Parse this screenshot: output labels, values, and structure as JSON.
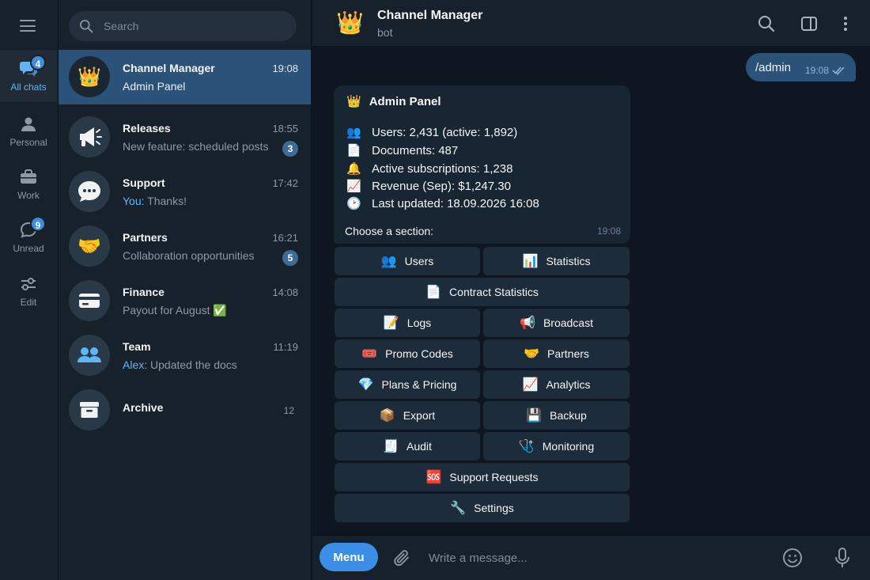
{
  "rail": {
    "folders": [
      {
        "label": "All chats",
        "badge": "4"
      },
      {
        "label": "Personal",
        "badge": ""
      },
      {
        "label": "Work",
        "badge": ""
      },
      {
        "label": "Unread",
        "badge": "9"
      },
      {
        "label": "Edit",
        "badge": ""
      }
    ]
  },
  "search": {
    "placeholder": "Search"
  },
  "chats": [
    {
      "name": "Channel Manager",
      "time": "19:08",
      "preview": "Admin Panel",
      "sender": "",
      "badge": "",
      "avatar": "👑"
    },
    {
      "name": "Releases",
      "time": "18:55",
      "preview": "New feature: scheduled posts",
      "sender": "",
      "badge": "3",
      "avatar": "megaphone-icon"
    },
    {
      "name": "Support",
      "time": "17:42",
      "preview": "Thanks!",
      "sender": "You:",
      "badge": "",
      "avatar": "speech-bubble-icon"
    },
    {
      "name": "Partners",
      "time": "16:21",
      "preview": "Collaboration opportunities",
      "sender": "",
      "badge": "5",
      "avatar": "🤝"
    },
    {
      "name": "Finance",
      "time": "14:08",
      "preview": "Payout for August ✅",
      "sender": "",
      "badge": "",
      "avatar": "credit-card-icon"
    },
    {
      "name": "Team",
      "time": "11:19",
      "preview": "Updated the docs",
      "sender": "Alex:",
      "badge": "",
      "avatar": "people-icon"
    },
    {
      "name": "Archive",
      "time": "",
      "preview": "",
      "sender": "",
      "badge": "12",
      "avatar": "archive-icon"
    }
  ],
  "header": {
    "title": "Channel Manager",
    "subtitle": "bot",
    "avatar": "👑"
  },
  "outgoing": {
    "text": "/admin",
    "time": "19:08"
  },
  "incoming": {
    "title": "Admin Panel",
    "title_emoji": "👑",
    "lines": [
      {
        "emoji": "👥",
        "text": "Users: 2,431 (active: 1,892)"
      },
      {
        "emoji": "📄",
        "text": "Documents: 487"
      },
      {
        "emoji": "🔔",
        "text": "Active subscriptions: 1,238"
      },
      {
        "emoji": "📈",
        "text": "Revenue (Sep): $1,247.30"
      },
      {
        "emoji": "🕑",
        "text": "Last updated: 18.09.2026 16:08"
      }
    ],
    "prompt": "Choose a section:",
    "time": "19:08"
  },
  "keyboard": [
    [
      {
        "emoji": "👥",
        "label": "Users"
      },
      {
        "emoji": "📊",
        "label": "Statistics"
      }
    ],
    [
      {
        "emoji": "📄",
        "label": "Contract Statistics"
      }
    ],
    [
      {
        "emoji": "📝",
        "label": "Logs"
      },
      {
        "emoji": "📢",
        "label": "Broadcast"
      }
    ],
    [
      {
        "emoji": "🎟️",
        "label": "Promo Codes"
      },
      {
        "emoji": "🤝",
        "label": "Partners"
      }
    ],
    [
      {
        "emoji": "💎",
        "label": "Plans & Pricing"
      },
      {
        "emoji": "📈",
        "label": "Analytics"
      }
    ],
    [
      {
        "emoji": "📦",
        "label": "Export"
      },
      {
        "emoji": "💾",
        "label": "Backup"
      }
    ],
    [
      {
        "emoji": "🧾",
        "label": "Audit"
      },
      {
        "emoji": "🩺",
        "label": "Monitoring"
      }
    ],
    [
      {
        "emoji": "🆘",
        "label": "Support Requests"
      }
    ],
    [
      {
        "emoji": "🔧",
        "label": "Settings"
      }
    ]
  ],
  "composer": {
    "menu_label": "Menu",
    "placeholder": "Write a message..."
  },
  "colors": {
    "accent": "#3a8ee6",
    "active_chat": "#2b5278",
    "background": "#0e1621",
    "panel": "#17212b",
    "link": "#6ab3f3"
  }
}
